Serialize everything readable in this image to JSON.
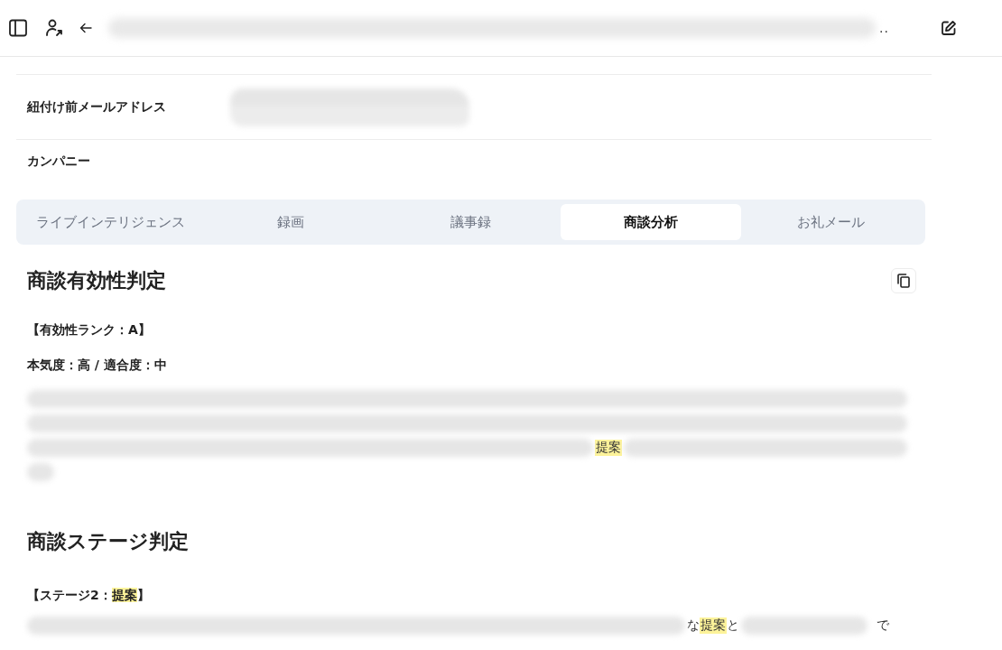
{
  "header": {
    "title_blurred": true,
    "title_tail": ".."
  },
  "fields": [
    {
      "label": "紐付け前メールアドレス",
      "value_blurred": true
    },
    {
      "label": "カンパニー",
      "value_blurred": false
    }
  ],
  "tabs": [
    {
      "label": "ライブインテリジェンス",
      "selected": false
    },
    {
      "label": "録画",
      "selected": false
    },
    {
      "label": "議事録",
      "selected": false
    },
    {
      "label": "商談分析",
      "selected": true
    },
    {
      "label": "お礼メール",
      "selected": false
    }
  ],
  "sections": [
    {
      "title": "商談有効性判定",
      "copy_button": true,
      "lines": [
        [
          {
            "kind": "text",
            "text": "【有効性ランク：A】"
          }
        ],
        [
          {
            "kind": "text",
            "text": "本気度：高 / 適合度：中"
          }
        ]
      ],
      "paragraph": [
        [
          {
            "kind": "blur"
          }
        ],
        [
          {
            "kind": "blur"
          }
        ],
        [
          {
            "kind": "blur"
          },
          {
            "kind": "highlight",
            "text": "提案"
          },
          {
            "kind": "blur"
          }
        ],
        [
          {
            "kind": "blur_tiny"
          }
        ]
      ]
    },
    {
      "title": "商談ステージ判定",
      "copy_button": false,
      "lines": [
        [
          {
            "kind": "text",
            "text": "【ステージ2："
          },
          {
            "kind": "highlight",
            "text": "提案"
          },
          {
            "kind": "text",
            "text": "】"
          }
        ]
      ],
      "paragraph": [
        [
          {
            "kind": "blur"
          },
          {
            "kind": "text",
            "text": "な"
          },
          {
            "kind": "highlight",
            "text": "提案"
          },
          {
            "kind": "text",
            "text": "と"
          },
          {
            "kind": "blur_short"
          },
          {
            "kind": "text",
            "text": "で"
          }
        ]
      ]
    }
  ]
}
